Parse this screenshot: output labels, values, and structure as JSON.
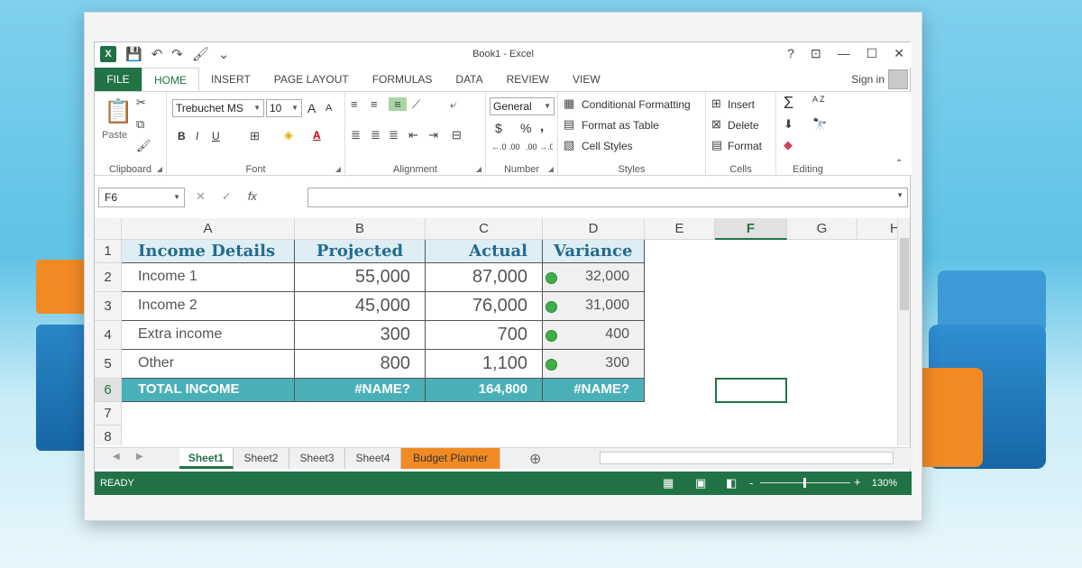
{
  "window": {
    "title": "Book1 - Excel",
    "help": "?",
    "controls": [
      "⊡",
      "—",
      "☐",
      "✕"
    ]
  },
  "qat": {
    "app_icon": "X",
    "save": "💾",
    "undo": "↶",
    "redo": "↷",
    "paint": "🖌",
    "customize": "⌄"
  },
  "tabs": [
    {
      "label": "FILE"
    },
    {
      "label": "HOME"
    },
    {
      "label": "INSERT"
    },
    {
      "label": "PAGE LAYOUT"
    },
    {
      "label": "FORMULAS"
    },
    {
      "label": "DATA"
    },
    {
      "label": "REVIEW"
    },
    {
      "label": "VIEW"
    }
  ],
  "signin": "Sign in",
  "ribbon": {
    "clipboard": {
      "label": "Clipboard",
      "paste": "Paste"
    },
    "font": {
      "label": "Font",
      "name": "Trebuchet MS",
      "size": "10",
      "grow": "A",
      "shrink": "A",
      "bold": "B",
      "italic": "I",
      "underline": "U",
      "font_color": "A"
    },
    "alignment": {
      "label": "Alignment"
    },
    "number": {
      "label": "Number",
      "format": "General",
      "currency": "$",
      "percent": "%",
      "comma": ",",
      "inc": "←.0 .00",
      "dec": ".00 →.0"
    },
    "styles": {
      "label": "Styles",
      "conditional": "Conditional Formatting",
      "format_table": "Format as Table",
      "cell_styles": "Cell Styles"
    },
    "cells": {
      "label": "Cells",
      "insert": "Insert",
      "delete": "Delete",
      "format": "Format"
    },
    "editing": {
      "label": "Editing",
      "sum": "Σ",
      "sort": "A Z"
    }
  },
  "formula_bar": {
    "name_box": "F6",
    "cancel": "✕",
    "enter": "✓",
    "fx": "fx",
    "value": ""
  },
  "columns": [
    "A",
    "B",
    "C",
    "D",
    "E",
    "F",
    "G",
    "H"
  ],
  "rows": [
    "1",
    "2",
    "3",
    "4",
    "5",
    "6",
    "7",
    "8"
  ],
  "table": {
    "headers": [
      "Income Details",
      "Projected",
      "Actual",
      "Variance"
    ],
    "rows": [
      {
        "label": "Income 1",
        "projected": "55,000",
        "actual": "87,000",
        "variance": "32,000"
      },
      {
        "label": "Income 2",
        "projected": "45,000",
        "actual": "76,000",
        "variance": "31,000"
      },
      {
        "label": "Extra income",
        "projected": "300",
        "actual": "700",
        "variance": "400"
      },
      {
        "label": "Other",
        "projected": "800",
        "actual": "1,100",
        "variance": "300"
      }
    ],
    "total": {
      "label": "TOTAL INCOME",
      "projected": "#NAME?",
      "actual": "164,800",
      "variance": "#NAME?"
    }
  },
  "sheets": [
    {
      "label": "Sheet1"
    },
    {
      "label": "Sheet2"
    },
    {
      "label": "Sheet3"
    },
    {
      "label": "Sheet4"
    },
    {
      "label": "Budget Planner"
    }
  ],
  "add_sheet": "⊕",
  "status": {
    "ready": "READY",
    "zoom": "130%",
    "zoom_minus": "-",
    "zoom_plus": "+"
  },
  "colors": {
    "excel_green": "#217346",
    "teal_total": "#4ab0b8",
    "header_fill": "#dfeef4",
    "status_dot": "#3fae49",
    "tab_orange": "#f28a24"
  }
}
